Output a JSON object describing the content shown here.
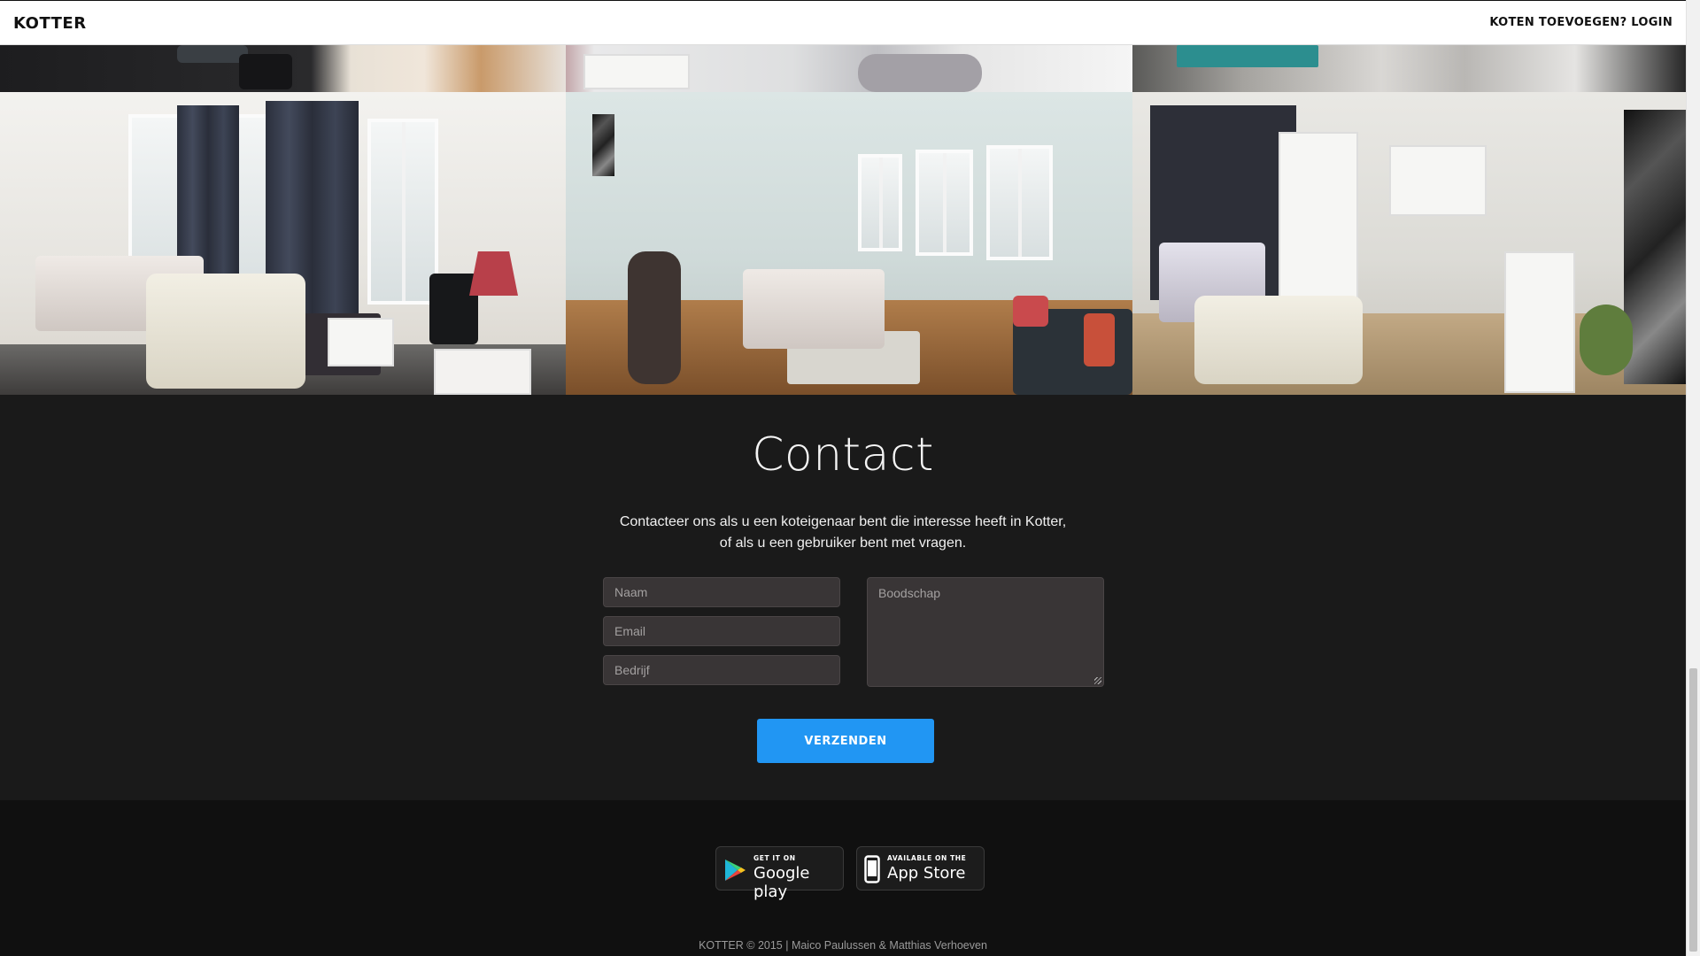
{
  "navbar": {
    "brand": "KOTTER",
    "add_rooms_link": "KOTEN TOEVOEGEN?",
    "login_link": "LOGIN"
  },
  "gallery": {
    "photos": [
      "room-photo-1",
      "room-photo-2",
      "room-photo-3"
    ]
  },
  "contact": {
    "title": "Contact",
    "intro_line1": "Contacteer ons als u een koteigenaar bent die interesse heeft in Kotter,",
    "intro_line2": "of als u een gebruiker bent met vragen.",
    "name_placeholder": "Naam",
    "email_placeholder": "Email",
    "company_placeholder": "Bedrijf",
    "message_placeholder": "Boodschap",
    "submit_label": "VERZENDEN"
  },
  "footer": {
    "google_play": {
      "small": "GET IT ON",
      "big": "Google play"
    },
    "app_store": {
      "small": "AVAILABLE ON THE",
      "big": "App Store"
    },
    "copyright": "KOTTER © 2015 | Maico Paulussen & Matthias Verhoeven"
  },
  "colors": {
    "accent": "#2196f3",
    "section_bg": "#1a1a1a",
    "footer_bg": "#101010",
    "field_bg": "#393536"
  }
}
